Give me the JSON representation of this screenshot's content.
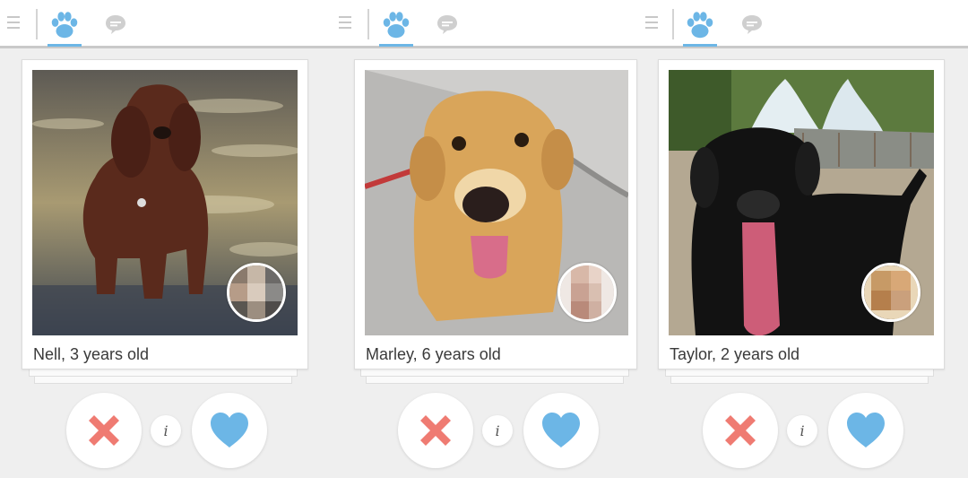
{
  "colors": {
    "accent": "#6cb6e6",
    "dislike": "#ef7b72",
    "like": "#6cb6e6"
  },
  "icons": {
    "menu": "hamburger-menu-icon",
    "paw": "paw-icon",
    "chat": "chat-bubble-icon",
    "dislike": "x-icon",
    "like": "heart-icon"
  },
  "profiles": [
    {
      "caption": "Nell, 3 years old",
      "info_label": "i"
    },
    {
      "caption": "Marley, 6 years old",
      "info_label": "i"
    },
    {
      "caption": "Taylor, 2 years old",
      "info_label": "i"
    }
  ]
}
